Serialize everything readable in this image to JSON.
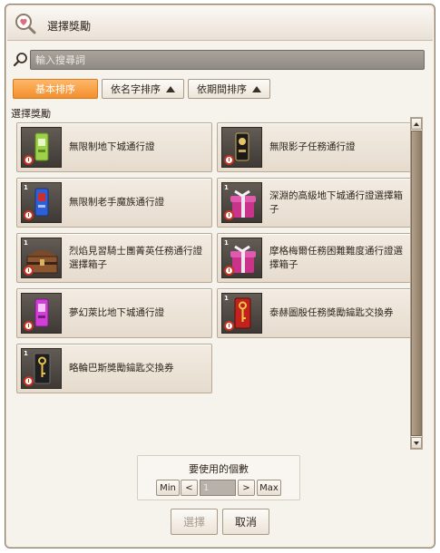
{
  "window": {
    "title": "選擇獎勵"
  },
  "search": {
    "placeholder": "輸入搜尋詞"
  },
  "sort": {
    "basic_label": "基本排序",
    "name_label": "依名字排序",
    "period_label": "依期間排序"
  },
  "section": {
    "label": "選擇獎勵"
  },
  "rewards": [
    {
      "name": "無限制地下城通行證",
      "icon": "green-pass-card-icon",
      "badge": ""
    },
    {
      "name": "無限影子任務通行證",
      "icon": "shadow-pass-card-icon",
      "badge": ""
    },
    {
      "name": "無限制老手魔族通行證",
      "icon": "blue-pass-card-icon",
      "badge": "1"
    },
    {
      "name": "深淵的高級地下城通行證選擇箱子",
      "icon": "pink-gift-box-icon",
      "badge": "1"
    },
    {
      "name": "烈焰見習騎士團菁英任務通行證選擇箱子",
      "icon": "treasure-chest-icon",
      "badge": "1"
    },
    {
      "name": "摩格梅爾任務困難難度通行證選擇箱子",
      "icon": "pink-gift-box-icon",
      "badge": "1"
    },
    {
      "name": "夢幻萊比地下城通行證",
      "icon": "magenta-pass-card-icon",
      "badge": ""
    },
    {
      "name": "泰赫圖殷任務獎勵鑰匙交換券",
      "icon": "red-key-ticket-icon",
      "badge": "1"
    },
    {
      "name": "略輪巴斯獎勵鑰匙交換券",
      "icon": "gold-key-ticket-icon",
      "badge": "1"
    }
  ],
  "quantity": {
    "label": "要使用的個數",
    "min_label": "Min",
    "prev_label": "<",
    "value": "1",
    "next_label": ">",
    "max_label": "Max"
  },
  "actions": {
    "select_label": "選擇",
    "cancel_label": "取消"
  },
  "colors": {
    "accent": "#f5a146",
    "panel": "#f6f2ec",
    "item_bg": "#ece3d7",
    "timer_red": "#c8321f"
  }
}
